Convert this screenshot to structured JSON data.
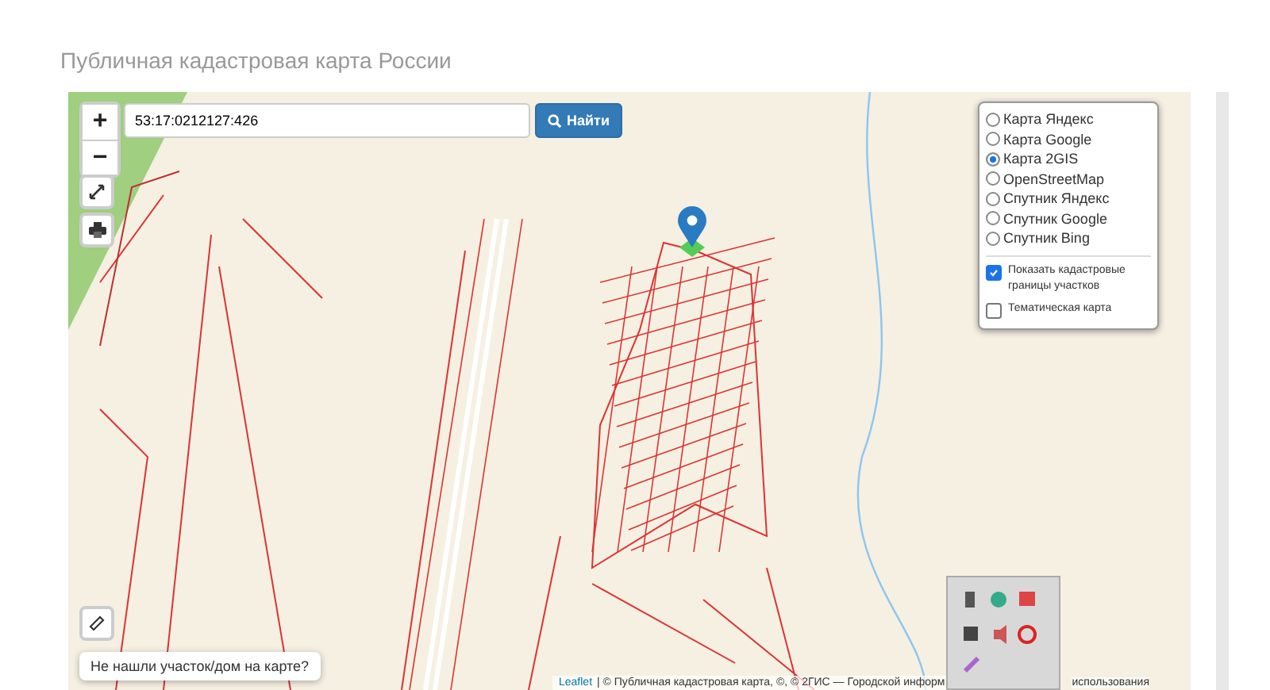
{
  "page": {
    "title": "Публичная кадастровая карта России"
  },
  "zoom": {
    "plus": "+",
    "minus": "−"
  },
  "search": {
    "value": "53:17:0212127:426",
    "button": "Найти"
  },
  "layers": [
    {
      "label": "Карта Яндекс",
      "selected": false
    },
    {
      "label": "Карта Google",
      "selected": false
    },
    {
      "label": "Карта 2GIS",
      "selected": true
    },
    {
      "label": "OpenStreetMap",
      "selected": false
    },
    {
      "label": "Спутник Яндекс",
      "selected": false
    },
    {
      "label": "Спутник Google",
      "selected": false
    },
    {
      "label": "Спутник Bing",
      "selected": false
    }
  ],
  "overlays": [
    {
      "label": "Показать кадастровые границы участков",
      "checked": true
    },
    {
      "label": "Тематическая карта",
      "checked": false
    }
  ],
  "not_found": "Не нашли участок/дом на карте?",
  "attribution": {
    "link": "Leaflet",
    "text": "| © Публичная кадастровая карта, ©, © 2ГИС — Городской информ",
    "tail": "использования"
  }
}
